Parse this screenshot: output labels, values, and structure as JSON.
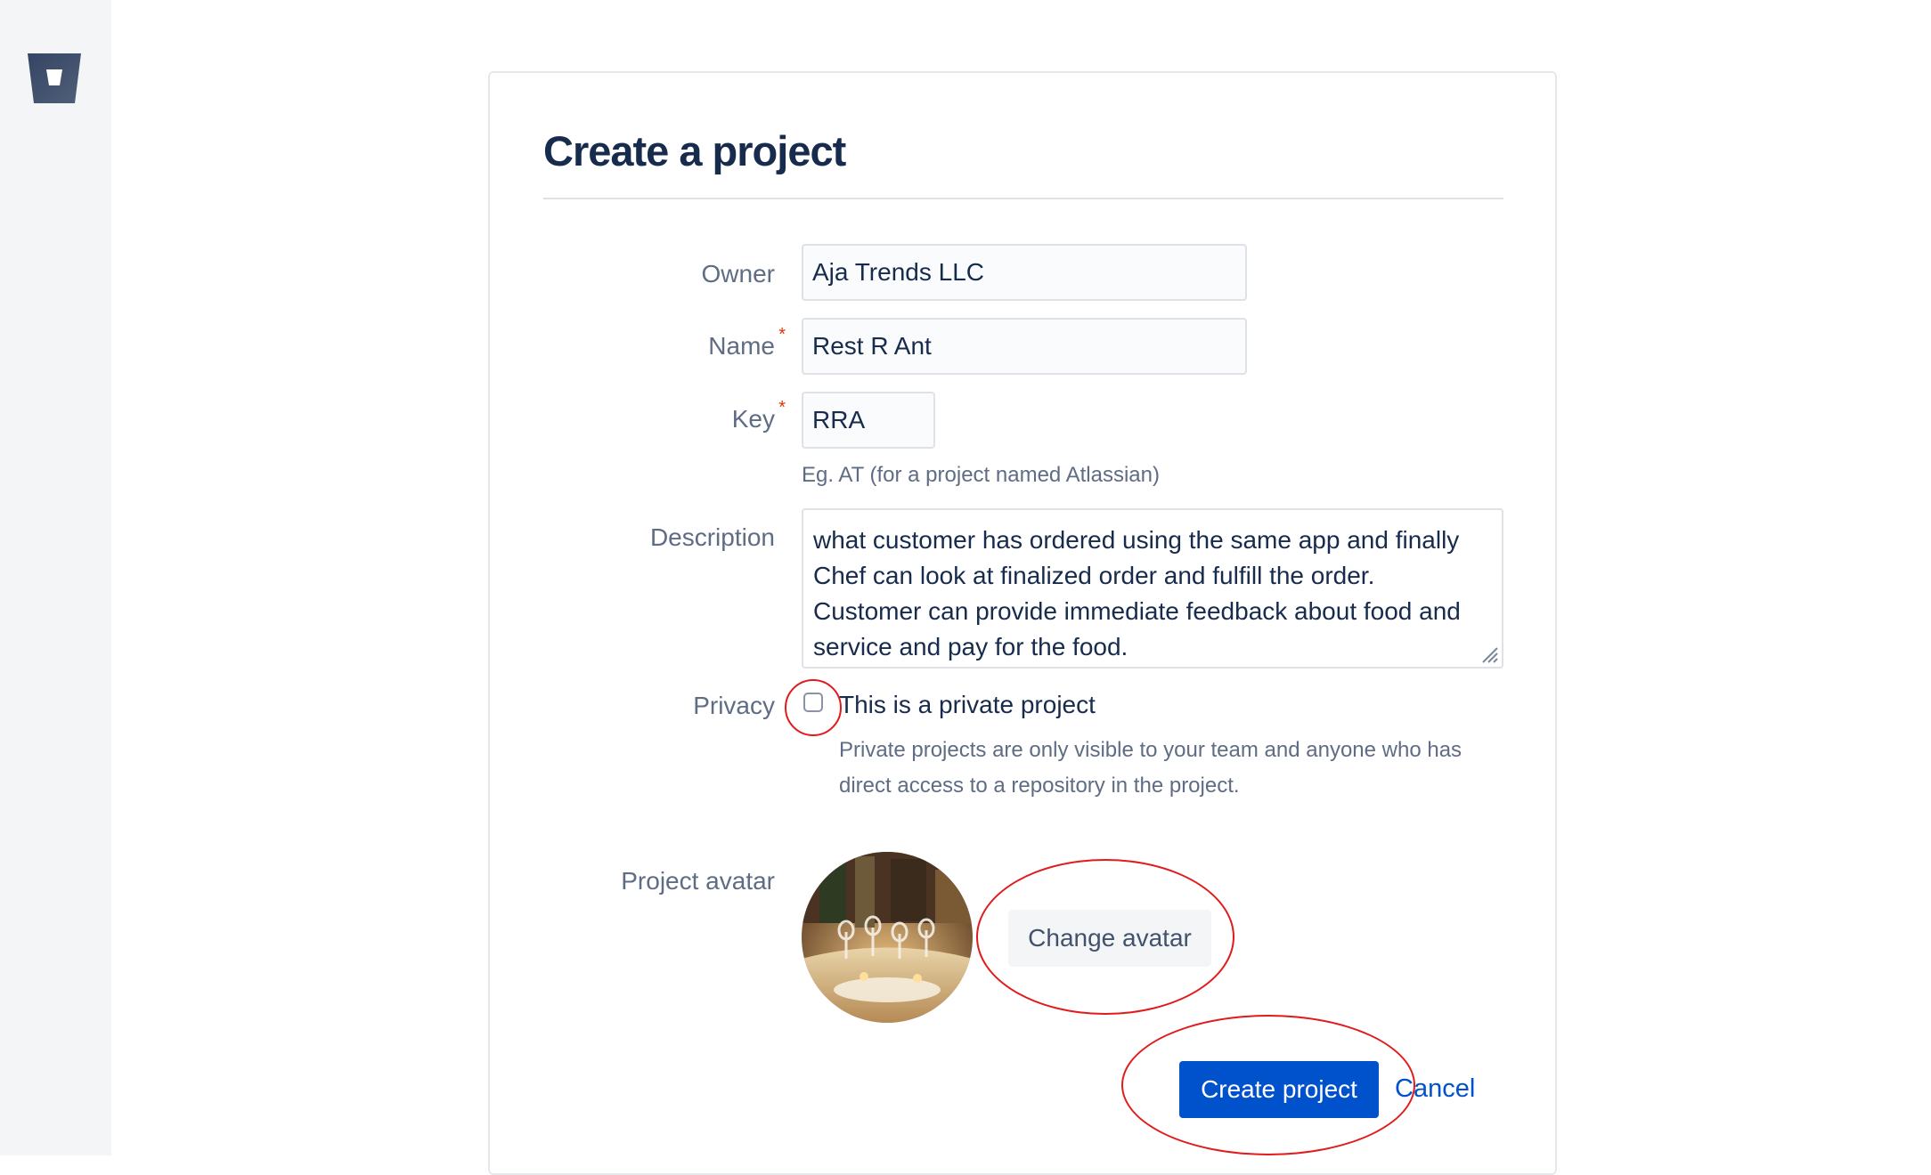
{
  "form": {
    "title": "Create a project",
    "owner": {
      "label": "Owner",
      "value": "Aja Trends LLC"
    },
    "name": {
      "label": "Name",
      "required_mark": "*",
      "value": "Rest R Ant"
    },
    "key": {
      "label": "Key",
      "required_mark": "*",
      "value": "RRA",
      "help": "Eg. AT (for a project named Atlassian)"
    },
    "description": {
      "label": "Description",
      "lines": [
        "what customer has ordered using the same app and finally",
        "Chef can look at finalized order and fulfill the order.",
        "Customer can provide immediate feedback about food and",
        "service and pay for the food."
      ]
    },
    "privacy": {
      "label": "Privacy",
      "checkbox_label": "This is a private project",
      "checked": false,
      "help_line1": "Private projects are only visible to your team and anyone who has",
      "help_line2": "direct access to a repository in the project."
    },
    "avatar": {
      "label": "Project avatar",
      "change_button": "Change avatar"
    },
    "actions": {
      "create": "Create project",
      "cancel": "Cancel"
    }
  },
  "icons": {
    "logo": "bitbucket-logo-icon",
    "resize": "resize-handle-icon"
  },
  "colors": {
    "primary": "#0052cc",
    "annotation": "#e11b1b",
    "required": "#de350b"
  }
}
